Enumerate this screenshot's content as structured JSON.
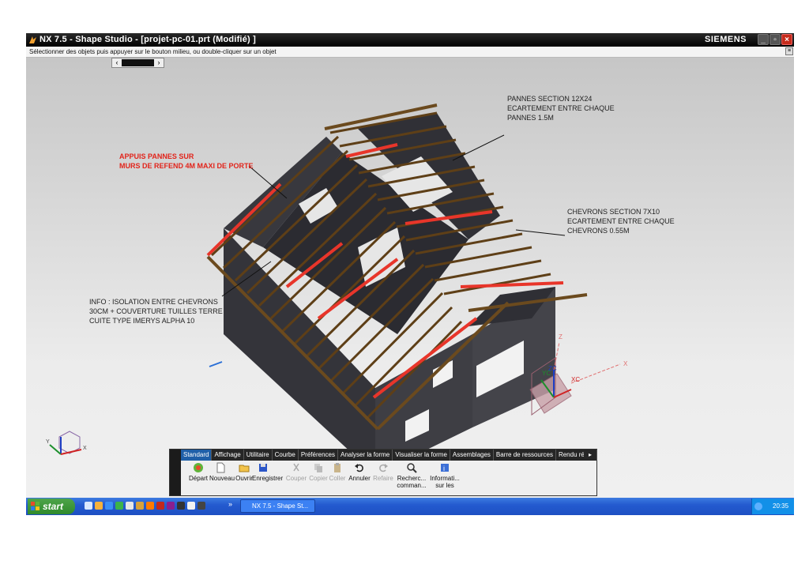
{
  "window": {
    "title": "NX 7.5 - Shape Studio - [projet-pc-01.prt (Modifié) ]",
    "brand": "SIEMENS",
    "min_label": "_",
    "max_label": "▫",
    "close_label": "×"
  },
  "prompt": {
    "text": "Sélectionner des objets puis appuyer sur le bouton milieu, ou double-cliquer sur un objet"
  },
  "annotations": {
    "pannes": "PANNES SECTION 12X24\nECARTEMENT ENTRE CHAQUE\nPANNES 1.5M",
    "appuis": "APPUIS PANNES SUR\nMURS DE REFEND 4M MAXI DE PORTE",
    "chevrons": "CHEVRONS SECTION 7X10\nECARTEMENT ENTRE CHAQUE\nCHEVRONS 0.55M",
    "info": "INFO : ISOLATION ENTRE CHEVRONS\n30CM + COUVERTURE TUILLES TERRE\nCUITE TYPE IMERYS ALPHA 10"
  },
  "axis_labels": {
    "zc": "ZC",
    "yc": "YC",
    "xc": "XC",
    "z": "Z",
    "y": "Y",
    "x": "X"
  },
  "toolbar": {
    "tabs": [
      "Standard",
      "Affichage",
      "Utilitaire",
      "Courbe",
      "Préférences",
      "Analyser la forme",
      "Visualiser la forme",
      "Assemblages",
      "Barre de ressources",
      "Rendu réalis"
    ],
    "active_tab": "Standard",
    "more": "▸",
    "tools": [
      {
        "label": "Départ",
        "icon": "start-icon",
        "enabled": true
      },
      {
        "label": "Nouveau",
        "icon": "new-file-icon",
        "enabled": true
      },
      {
        "label": "Ouvrir",
        "icon": "open-folder-icon",
        "enabled": true
      },
      {
        "label": "Enregistrer",
        "icon": "save-icon",
        "enabled": true
      },
      {
        "label": "Couper",
        "icon": "cut-icon",
        "enabled": false
      },
      {
        "label": "Copier",
        "icon": "copy-icon",
        "enabled": false
      },
      {
        "label": "Coller",
        "icon": "paste-icon",
        "enabled": false
      },
      {
        "label": "Annuler",
        "icon": "undo-icon",
        "enabled": true
      },
      {
        "label": "Refaire",
        "icon": "redo-icon",
        "enabled": false
      },
      {
        "label": "Recherc... comman...",
        "icon": "command-finder-icon",
        "enabled": true
      },
      {
        "label": "Informati... sur les",
        "icon": "information-icon",
        "enabled": true
      }
    ]
  },
  "taskbar": {
    "start": "start",
    "task": "NX 7.5 - Shape St...",
    "overflow": "»",
    "clock": "20:35"
  },
  "colors": {
    "wall": "#3a3a40",
    "beam": "#6b4a1e",
    "purlin_highlight": "#e8352a",
    "annotation_red": "#e2241b",
    "taskbar": "#245bd0"
  }
}
